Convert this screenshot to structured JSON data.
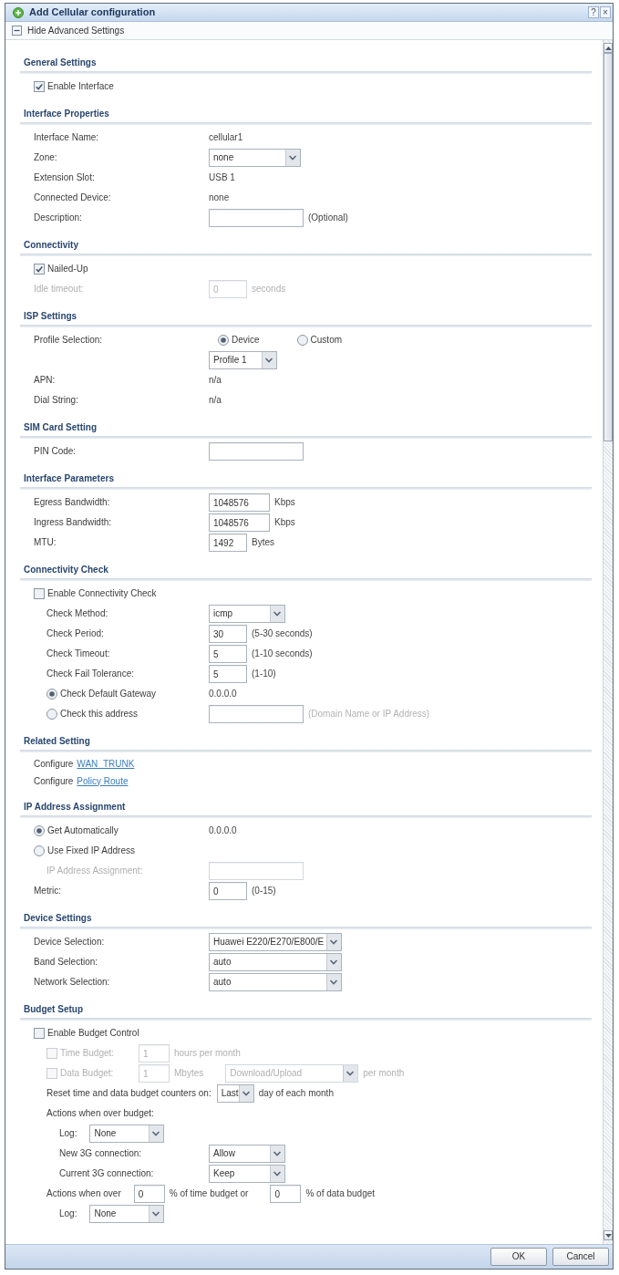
{
  "window": {
    "title": "Add Cellular configuration",
    "help_button": "?",
    "close_button": "×"
  },
  "toolbar": {
    "toggle_label": "Hide Advanced Settings"
  },
  "sections": [
    {
      "title": "General Settings",
      "rows": [
        {
          "kind": "checkbox",
          "label": "Enable Interface",
          "checked": true,
          "disabled": false
        }
      ]
    },
    {
      "title": "Interface Properties",
      "rows": [
        {
          "kind": "field",
          "label": "Interface Name:",
          "disabled": false,
          "parts": [
            {
              "kind": "text",
              "text": "cellular1"
            }
          ]
        },
        {
          "kind": "field",
          "label": "Zone:",
          "disabled": false,
          "parts": [
            {
              "kind": "select",
              "value": "none"
            }
          ]
        },
        {
          "kind": "field",
          "label": "Extension Slot:",
          "disabled": false,
          "parts": [
            {
              "kind": "text",
              "text": "USB 1"
            }
          ]
        },
        {
          "kind": "field",
          "label": "Connected Device:",
          "disabled": false,
          "parts": [
            {
              "kind": "text",
              "text": "none"
            }
          ]
        },
        {
          "kind": "field",
          "label": "Description:",
          "disabled": false,
          "parts": [
            {
              "kind": "input"
            },
            {
              "kind": "text",
              "text": "(Optional)"
            }
          ]
        }
      ]
    },
    {
      "title": "Connectivity",
      "rows": [
        {
          "kind": "checkbox",
          "label": "Nailed-Up",
          "checked": true,
          "disabled": false
        },
        {
          "kind": "field",
          "label": "Idle timeout:",
          "disabled": true,
          "parts": [
            {
              "kind": "input",
              "value": "0"
            },
            {
              "kind": "text",
              "text": "seconds"
            }
          ]
        }
      ]
    },
    {
      "title": "ISP Settings",
      "rows": [
        {
          "kind": "field",
          "label": "Profile Selection:",
          "disabled": false,
          "parts": [
            {
              "kind": "radio",
              "label": "Device",
              "selected": true
            },
            {
              "kind": "radio",
              "label": "Custom",
              "selected": false
            }
          ]
        },
        {
          "kind": "field",
          "disabled": false,
          "parts": [
            {
              "kind": "select",
              "value": "Profile 1"
            }
          ]
        },
        {
          "kind": "field",
          "label": "APN:",
          "disabled": false,
          "parts": [
            {
              "kind": "text",
              "text": "n/a"
            }
          ]
        },
        {
          "kind": "field",
          "label": "Dial String:",
          "disabled": false,
          "parts": [
            {
              "kind": "text",
              "text": "n/a"
            }
          ]
        }
      ]
    },
    {
      "title": "SIM Card Setting",
      "rows": [
        {
          "kind": "field",
          "label": "PIN Code:",
          "disabled": false,
          "parts": [
            {
              "kind": "input"
            }
          ]
        }
      ]
    },
    {
      "title": "Interface Parameters",
      "rows": [
        {
          "kind": "field",
          "label": "Egress Bandwidth:",
          "disabled": false,
          "parts": [
            {
              "kind": "input",
              "value": "1048576"
            },
            {
              "kind": "text",
              "text": "Kbps"
            }
          ]
        },
        {
          "kind": "field",
          "label": "Ingress Bandwidth:",
          "disabled": false,
          "parts": [
            {
              "kind": "input",
              "value": "1048576"
            },
            {
              "kind": "text",
              "text": "Kbps"
            }
          ]
        },
        {
          "kind": "field",
          "label": "MTU:",
          "disabled": false,
          "parts": [
            {
              "kind": "input",
              "value": "1492"
            },
            {
              "kind": "text",
              "text": "Bytes"
            }
          ]
        }
      ]
    },
    {
      "title": "Connectivity Check",
      "rows": [
        {
          "kind": "checkbox",
          "label": "Enable Connectivity Check",
          "checked": false,
          "disabled": false,
          "children": [
            {
              "kind": "field",
              "label": "Check Method:",
              "disabled": false,
              "parts": [
                {
                  "kind": "select",
                  "value": "icmp"
                }
              ]
            },
            {
              "kind": "field",
              "label": "Check Period:",
              "disabled": false,
              "parts": [
                {
                  "kind": "input",
                  "value": "30"
                },
                {
                  "kind": "text",
                  "text": "(5-30 seconds)"
                }
              ]
            },
            {
              "kind": "field",
              "label": "Check Timeout:",
              "disabled": false,
              "parts": [
                {
                  "kind": "input",
                  "value": "5"
                },
                {
                  "kind": "text",
                  "text": "(1-10 seconds)"
                }
              ]
            },
            {
              "kind": "field",
              "label": "Check Fail Tolerance:",
              "disabled": false,
              "parts": [
                {
                  "kind": "input",
                  "value": "5"
                },
                {
                  "kind": "text",
                  "text": "(1-10)"
                }
              ]
            },
            {
              "kind": "radio",
              "label": "Check Default Gateway",
              "selected": true,
              "disabled": false,
              "parts": [
                {
                  "kind": "text",
                  "text": "0.0.0.0"
                }
              ]
            },
            {
              "kind": "radio",
              "label": "Check this address",
              "selected": false,
              "disabled": false,
              "parts": [
                {
                  "kind": "input"
                },
                {
                  "kind": "hint",
                  "text": "(Domain Name or IP Address)"
                }
              ]
            }
          ]
        }
      ]
    },
    {
      "title": "Related Setting",
      "rows": [
        {
          "kind": "link_line",
          "label": "Configure",
          "link": "WAN_TRUNK",
          "disabled": false
        },
        {
          "kind": "link_line",
          "label": "Configure",
          "link": "Policy Route",
          "disabled": false
        }
      ]
    },
    {
      "title": "IP Address Assignment",
      "rows": [
        {
          "kind": "radio",
          "label": "Get Automatically",
          "selected": true,
          "disabled": false,
          "parts": [
            {
              "kind": "text",
              "text": "0.0.0.0"
            }
          ]
        },
        {
          "kind": "radio",
          "label": "Use Fixed IP Address",
          "selected": false,
          "disabled": false,
          "children": [
            {
              "kind": "field",
              "label": "IP Address Assignment:",
              "disabled": true,
              "parts": [
                {
                  "kind": "input"
                }
              ]
            }
          ]
        },
        {
          "kind": "field",
          "label": "Metric:",
          "disabled": false,
          "parts": [
            {
              "kind": "input",
              "value": "0"
            },
            {
              "kind": "text",
              "text": "(0-15)"
            }
          ]
        }
      ]
    },
    {
      "title": "Device Settings",
      "rows": [
        {
          "kind": "field",
          "label": "Device Selection:",
          "disabled": false,
          "parts": [
            {
              "kind": "select",
              "value": "Huawei E220/E270/E800/E"
            }
          ]
        },
        {
          "kind": "field",
          "label": "Band Selection:",
          "disabled": false,
          "parts": [
            {
              "kind": "select",
              "value": "auto"
            }
          ]
        },
        {
          "kind": "field",
          "label": "Network Selection:",
          "disabled": false,
          "parts": [
            {
              "kind": "select",
              "value": "auto"
            }
          ]
        }
      ]
    },
    {
      "title": "Budget Setup",
      "rows": [
        {
          "kind": "checkbox",
          "label": "Enable Budget Control",
          "checked": false,
          "disabled": false,
          "children": [
            {
              "kind": "checkbox",
              "label": "Time Budget:",
              "checked": false,
              "disabled": true,
              "parts": [
                {
                  "kind": "input",
                  "value": "1"
                },
                {
                  "kind": "text",
                  "text": "hours per month"
                }
              ]
            },
            {
              "kind": "checkbox",
              "label": "Data Budget:",
              "checked": false,
              "disabled": true,
              "parts": [
                {
                  "kind": "input",
                  "value": "1"
                },
                {
                  "kind": "text",
                  "text": "Mbytes"
                },
                {
                  "kind": "select",
                  "value": "Download/Upload"
                },
                {
                  "kind": "text",
                  "text": "per month"
                }
              ]
            },
            {
              "kind": "field",
              "label": "Reset time and data budget counters on:",
              "disabled": false,
              "parts": [
                {
                  "kind": "select",
                  "value": "Last"
                },
                {
                  "kind": "text",
                  "text": "day of each month"
                }
              ]
            },
            {
              "kind": "field",
              "label": "Actions when over budget:",
              "disabled": false,
              "children": [
                {
                  "kind": "inline_field",
                  "label": "Log:",
                  "disabled": false,
                  "parts": [
                    {
                      "kind": "select",
                      "value": "None"
                    }
                  ]
                },
                {
                  "kind": "field",
                  "label": "New 3G connection:",
                  "disabled": false,
                  "parts": [
                    {
                      "kind": "select",
                      "value": "Allow"
                    }
                  ]
                },
                {
                  "kind": "field",
                  "label": "Current 3G connection:",
                  "disabled": false,
                  "parts": [
                    {
                      "kind": "select",
                      "value": "Keep"
                    }
                  ]
                }
              ]
            },
            {
              "kind": "inline_field",
              "label": "Actions when over",
              "disabled": false,
              "parts": [
                {
                  "kind": "input",
                  "value": "0"
                },
                {
                  "kind": "text",
                  "text": "% of time budget or"
                },
                {
                  "kind": "input",
                  "value": "0"
                },
                {
                  "kind": "text",
                  "text": "% of data budget"
                }
              ],
              "children": [
                {
                  "kind": "inline_field",
                  "label": "Log:",
                  "disabled": false,
                  "parts": [
                    {
                      "kind": "select",
                      "value": "None"
                    }
                  ]
                }
              ]
            }
          ]
        }
      ]
    }
  ],
  "buttons": [
    "OK",
    "Cancel"
  ]
}
